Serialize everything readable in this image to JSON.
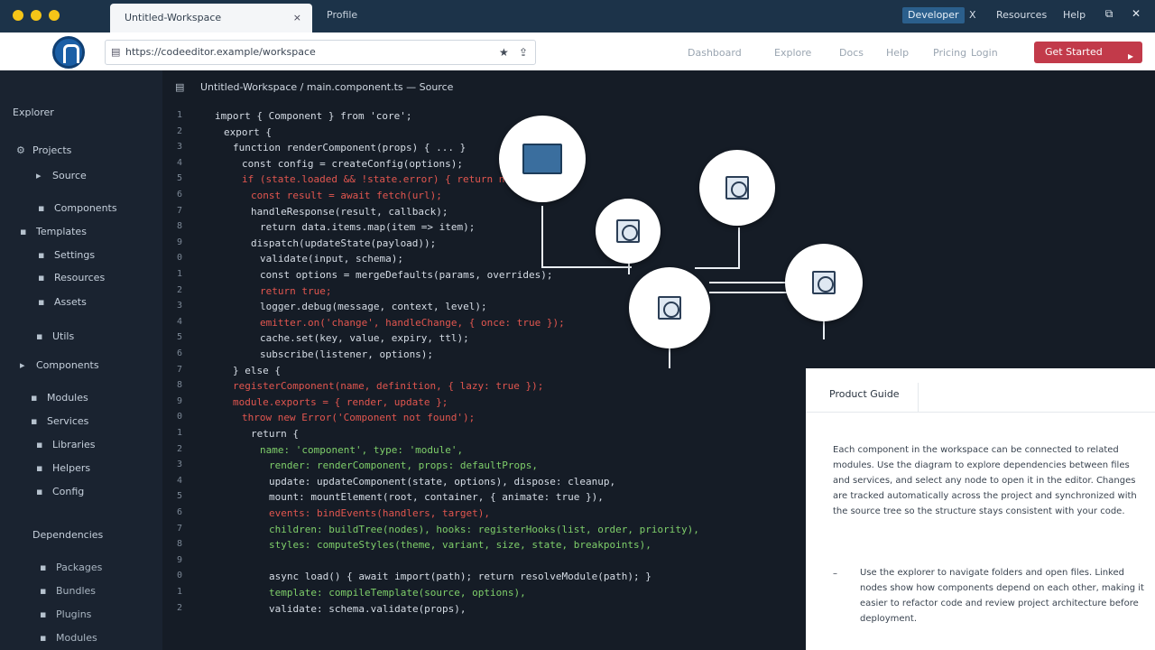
{
  "titlebar": {
    "tab_active_label": "Untitled-Workspace",
    "tab_inactive_label": "Profile",
    "badge_label": "Developer",
    "right_items": [
      "X",
      "Resources",
      "Help"
    ],
    "close_tab": "×",
    "minimize": "⧉",
    "close_window": "✕"
  },
  "header": {
    "url_text": "https://codeeditor.example/workspace",
    "nav_links": [
      "Dashboard",
      "Explore",
      "Docs",
      "Help",
      "Pricing",
      "Login"
    ],
    "cta_label": "Get Started",
    "accent_color": "#c23a4a"
  },
  "sidebar": {
    "heading": "Explorer",
    "items": [
      {
        "label": "Projects",
        "icon": "gear-icon"
      },
      {
        "label": "Source",
        "icon": "folder-icon"
      },
      {
        "label": "Components",
        "icon": "file-icon"
      },
      {
        "label": "Templates",
        "icon": "file-icon"
      },
      {
        "label": "Settings",
        "icon": "file-icon"
      },
      {
        "label": "Resources",
        "icon": "file-icon"
      },
      {
        "label": "Assets",
        "icon": "file-icon"
      },
      {
        "label": "Utils",
        "icon": "file-icon"
      },
      {
        "label": "Components",
        "icon": "folder-icon"
      },
      {
        "label": "Modules",
        "icon": "file-icon"
      },
      {
        "label": "Services",
        "icon": "file-icon"
      },
      {
        "label": "Libraries",
        "icon": "file-icon"
      },
      {
        "label": "Helpers",
        "icon": "file-icon"
      },
      {
        "label": "Config",
        "icon": "file-icon"
      }
    ],
    "section2_heading": "Dependencies",
    "section2_items": [
      "Packages",
      "Bundles",
      "Plugins",
      "Modules"
    ]
  },
  "editor": {
    "title": "Untitled-Workspace / main.component.ts — Source",
    "lines": [
      {
        "text": "import { Component } from 'core';",
        "color": "#d6dde6",
        "indent": 0
      },
      {
        "text": "export {",
        "color": "#d6dde6",
        "indent": 1
      },
      {
        "text": "  function renderComponent(props) { ... }",
        "color": "#d6dde6",
        "indent": 2
      },
      {
        "text": "  const config = createConfig(options);",
        "color": "#d6dde6",
        "indent": 3
      },
      {
        "text": "  if (state.loaded && !state.error) { return null; }",
        "color": "#e2564f",
        "indent": 3
      },
      {
        "text": "    const result = await fetch(url);",
        "color": "#e2564f",
        "indent": 4
      },
      {
        "text": "    handleResponse(result, callback);",
        "color": "#d6dde6",
        "indent": 4
      },
      {
        "text": "    return data.items.map(item => item);",
        "color": "#d6dde6",
        "indent": 5
      },
      {
        "text": "    dispatch(updateState(payload));",
        "color": "#d6dde6",
        "indent": 4
      },
      {
        "text": "    validate(input, schema);",
        "color": "#d6dde6",
        "indent": 5
      },
      {
        "text": "    const options = mergeDefaults(params, overrides);",
        "color": "#d6dde6",
        "indent": 5
      },
      {
        "text": "    return true;",
        "color": "#e2564f",
        "indent": 5
      },
      {
        "text": "    logger.debug(message, context, level);",
        "color": "#d6dde6",
        "indent": 5
      },
      {
        "text": "    emitter.on('change', handleChange, { once: true });",
        "color": "#e2564f",
        "indent": 5
      },
      {
        "text": "    cache.set(key, value, expiry, ttl);",
        "color": "#d6dde6",
        "indent": 5
      },
      {
        "text": "    subscribe(listener, options);",
        "color": "#d6dde6",
        "indent": 5
      },
      {
        "text": "  } else {",
        "color": "#d6dde6",
        "indent": 2
      },
      {
        "text": "  registerComponent(name, definition, { lazy: true });",
        "color": "#e2564f",
        "indent": 2
      },
      {
        "text": "  module.exports = { render, update };",
        "color": "#e2564f",
        "indent": 2
      },
      {
        "text": "  throw new Error('Component not found');",
        "color": "#e2564f",
        "indent": 3
      },
      {
        "text": "    return {",
        "color": "#d6dde6",
        "indent": 4
      },
      {
        "text": "      name: 'component', type: 'module',",
        "color": "#7fcf6a",
        "indent": 5
      },
      {
        "text": "      render: renderComponent,      props: defaultProps,",
        "color": "#7fcf6a",
        "indent": 6
      },
      {
        "text": "      update: updateComponent(state, options),    dispose: cleanup,",
        "color": "#d6dde6",
        "indent": 6
      },
      {
        "text": "      mount: mountElement(root, container, { animate: true }),",
        "color": "#d6dde6",
        "indent": 6
      },
      {
        "text": "      events: bindEvents(handlers, target),",
        "color": "#e2564f",
        "indent": 6
      },
      {
        "text": "      children: buildTree(nodes),        hooks: registerHooks(list, order, priority),",
        "color": "#7fcf6a",
        "indent": 6
      },
      {
        "text": "      styles: computeStyles(theme, variant, size, state, breakpoints),",
        "color": "#7fcf6a",
        "indent": 6
      },
      {
        "text": "",
        "color": "#d6dde6",
        "indent": 6
      },
      {
        "text": "      async load() { await import(path); return resolveModule(path); }",
        "color": "#d6dde6",
        "indent": 6
      },
      {
        "text": "      template: compileTemplate(source, options),",
        "color": "#7fcf6a",
        "indent": 6
      },
      {
        "text": "      validate: schema.validate(props),",
        "color": "#d6dde6",
        "indent": 6
      }
    ]
  },
  "panel": {
    "title": "Product Guide",
    "paragraph1": "Each component in the workspace can be connected to related modules. Use the diagram to explore dependencies between files and services, and select any node to open it in the editor. Changes are tracked automatically across the project and synchronized with the source tree so the structure stays consistent with your code.",
    "bullet": "–",
    "paragraph2": "Use the explorer to navigate folders and open files. Linked nodes show how components depend on each other, making it easier to refactor code and review project architecture before deployment."
  }
}
